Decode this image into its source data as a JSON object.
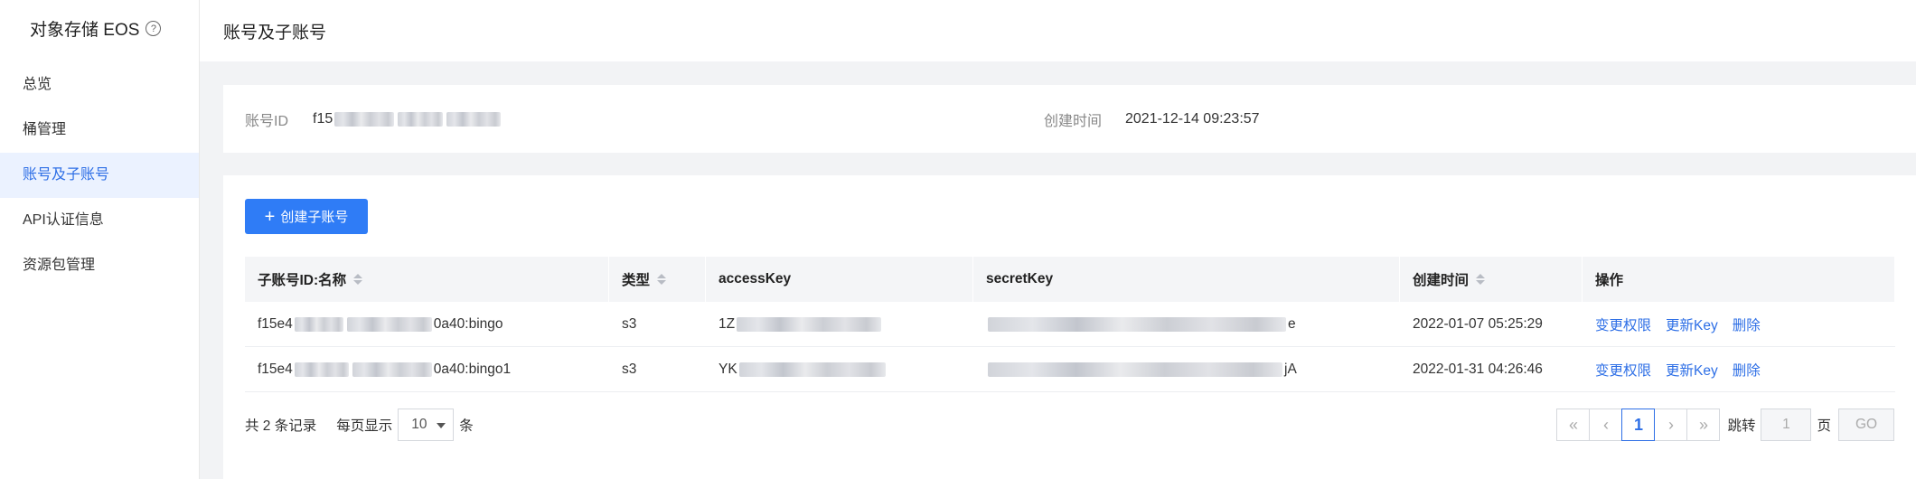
{
  "sidebar": {
    "title": "对象存储 EOS",
    "help_icon": "question-circle-icon",
    "items": [
      {
        "label": "总览"
      },
      {
        "label": "桶管理"
      },
      {
        "label": "账号及子账号",
        "active": true
      },
      {
        "label": "API认证信息"
      },
      {
        "label": "资源包管理"
      }
    ]
  },
  "header": {
    "title": "账号及子账号"
  },
  "account": {
    "id_label": "账号ID",
    "id_prefix": "f15",
    "created_label": "创建时间",
    "created_value": "2021-12-14 09:23:57"
  },
  "create_button": {
    "label": "创建子账号",
    "icon": "plus-icon"
  },
  "table": {
    "columns": [
      "子账号ID:名称",
      "类型",
      "accessKey",
      "secretKey",
      "创建时间",
      "操作"
    ],
    "rows": [
      {
        "id_prefix": "f15e4",
        "id_suffix": "0a40:bingo",
        "type": "s3",
        "access_prefix": "1Z",
        "secret_suffix": "e",
        "created": "2022-01-07 05:25:29"
      },
      {
        "id_prefix": "f15e4",
        "id_suffix": "0a40:bingo1",
        "type": "s3",
        "access_prefix": "YK",
        "secret_suffix": "jA",
        "created": "2022-01-31 04:26:46"
      }
    ],
    "actions": [
      "变更权限",
      "更新Key",
      "删除"
    ]
  },
  "footer": {
    "total_text": "共 2 条记录",
    "per_page_label": "每页显示",
    "per_page_value": "10",
    "per_page_unit": "条",
    "current_page": "1",
    "jump_label": "跳转",
    "jump_value": "1",
    "page_unit": "页",
    "go_label": "GO"
  },
  "colors": {
    "accent": "#2e6fe6",
    "button": "#2f7cf6",
    "active_bg": "#ebf2ff"
  }
}
